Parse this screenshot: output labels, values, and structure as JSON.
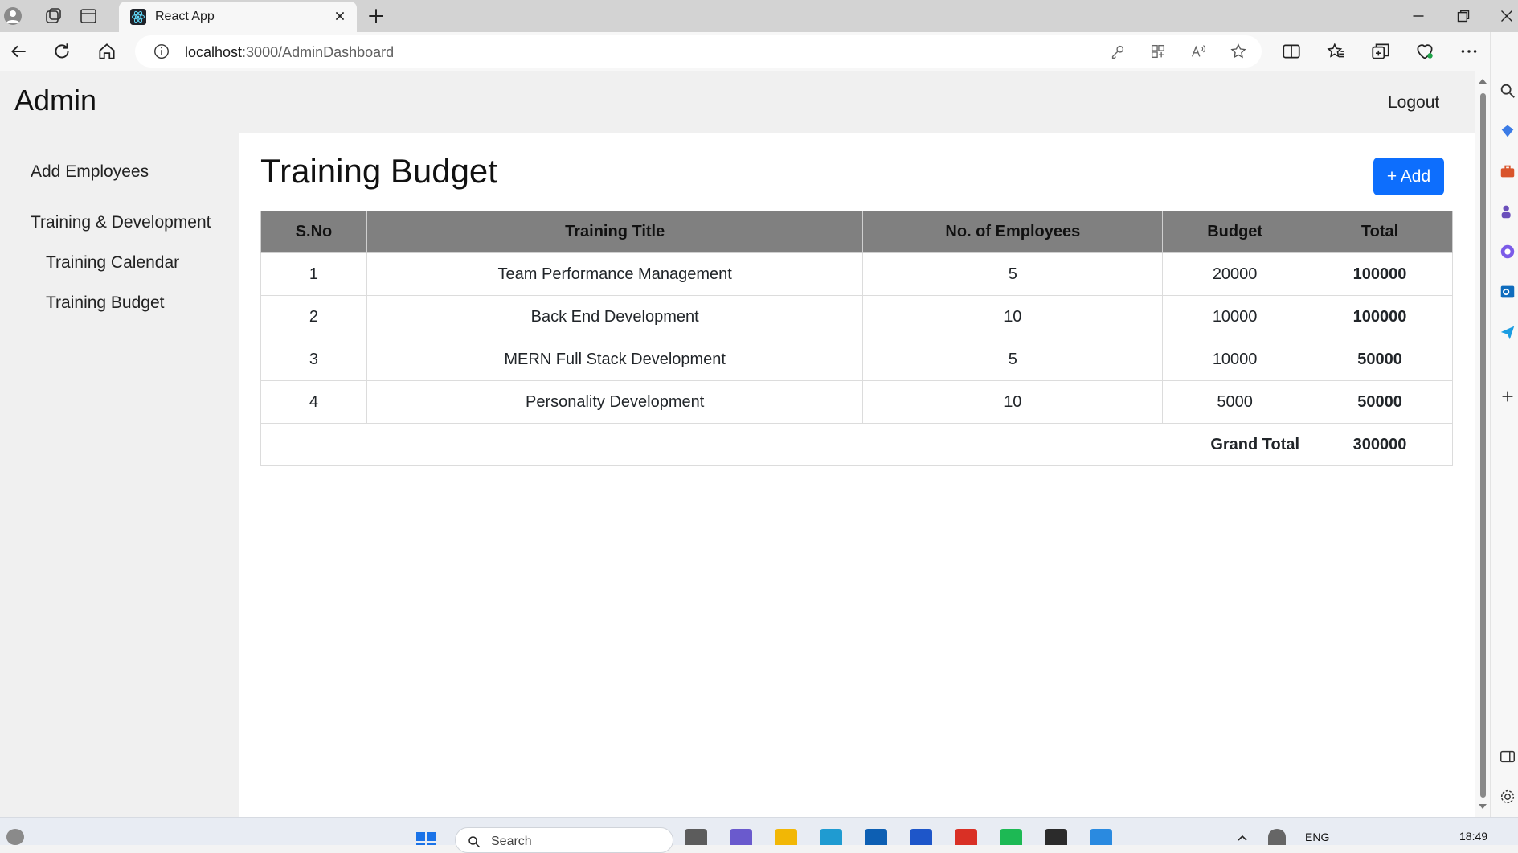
{
  "browser": {
    "tab_title": "React App",
    "url_host": "localhost",
    "url_path": ":3000/AdminDashboard"
  },
  "header": {
    "brand": "Admin",
    "logout_label": "Logout"
  },
  "sidebar": {
    "items": [
      {
        "label": "Add Employees"
      },
      {
        "label": "Training & Development"
      },
      {
        "label": "Training Calendar"
      },
      {
        "label": "Training Budget"
      }
    ]
  },
  "main": {
    "title": "Training Budget",
    "add_label": "+ Add",
    "table": {
      "headers": [
        "S.No",
        "Training Title",
        "No. of Employees",
        "Budget",
        "Total"
      ],
      "rows": [
        {
          "sno": "1",
          "title": "Team Performance Management",
          "employees": "5",
          "budget": "20000",
          "total": "100000"
        },
        {
          "sno": "2",
          "title": "Back End Development",
          "employees": "10",
          "budget": "10000",
          "total": "100000"
        },
        {
          "sno": "3",
          "title": "MERN Full Stack Development",
          "employees": "5",
          "budget": "10000",
          "total": "50000"
        },
        {
          "sno": "4",
          "title": "Personality Development",
          "employees": "10",
          "budget": "5000",
          "total": "50000"
        }
      ],
      "grand_total_label": "Grand Total",
      "grand_total_value": "300000"
    }
  },
  "taskbar": {
    "search_placeholder": "Search",
    "language": "ENG",
    "time": "18:49"
  },
  "colors": {
    "accent": "#0d6efd",
    "table_header_bg": "#808080"
  }
}
